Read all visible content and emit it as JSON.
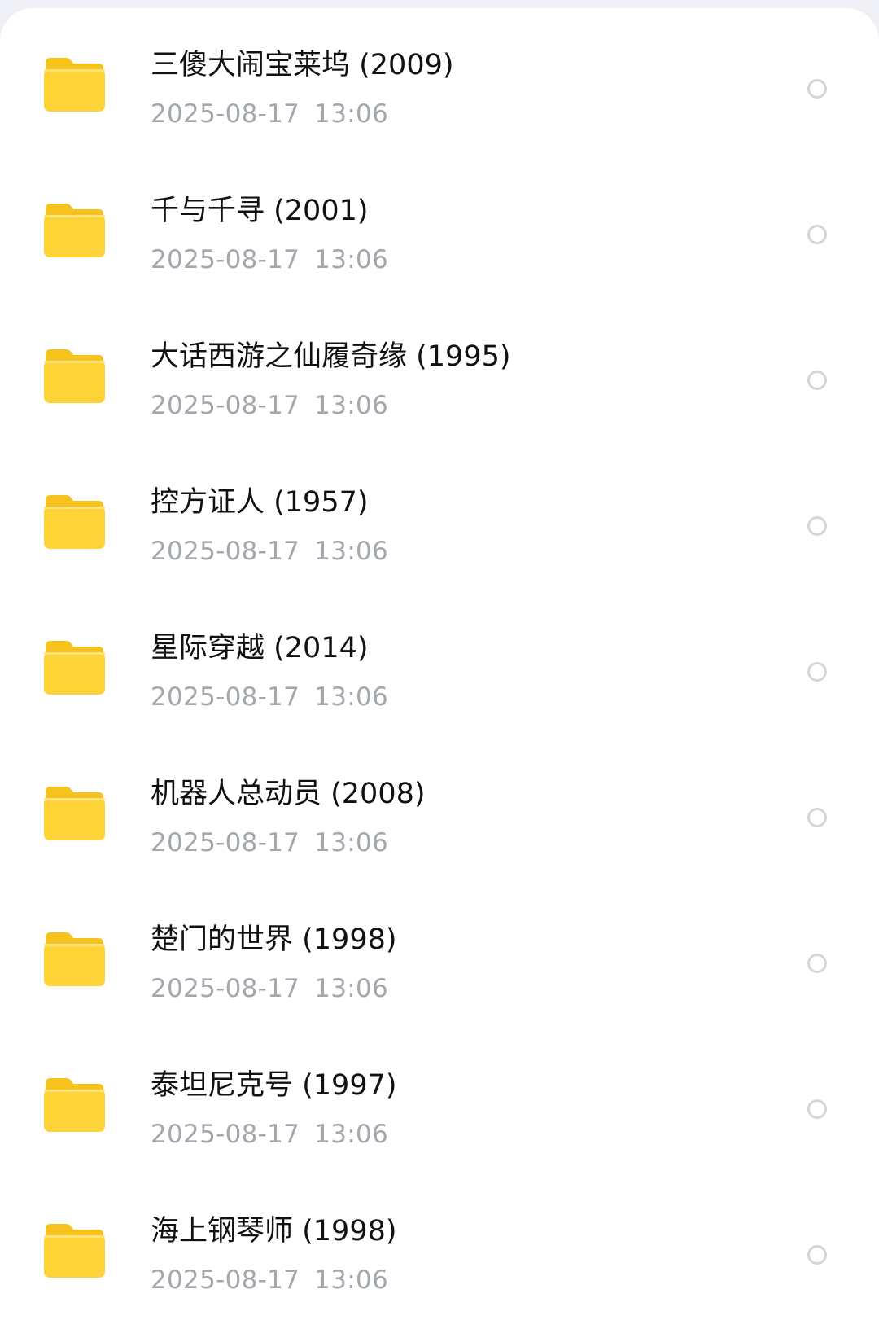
{
  "files": [
    {
      "name": "三傻大闹宝莱坞 (2009)",
      "date": "2025-08-17",
      "time": "13:06",
      "icon": "folder-icon"
    },
    {
      "name": "千与千寻 (2001)",
      "date": "2025-08-17",
      "time": "13:06",
      "icon": "folder-icon"
    },
    {
      "name": "大话西游之仙履奇缘 (1995)",
      "date": "2025-08-17",
      "time": "13:06",
      "icon": "folder-icon"
    },
    {
      "name": "控方证人 (1957)",
      "date": "2025-08-17",
      "time": "13:06",
      "icon": "folder-icon"
    },
    {
      "name": "星际穿越 (2014)",
      "date": "2025-08-17",
      "time": "13:06",
      "icon": "folder-icon"
    },
    {
      "name": "机器人总动员 (2008)",
      "date": "2025-08-17",
      "time": "13:06",
      "icon": "folder-icon"
    },
    {
      "name": "楚门的世界 (1998)",
      "date": "2025-08-17",
      "time": "13:06",
      "icon": "folder-icon"
    },
    {
      "name": "泰坦尼克号 (1997)",
      "date": "2025-08-17",
      "time": "13:06",
      "icon": "folder-icon"
    },
    {
      "name": "海上钢琴师 (1998)",
      "date": "2025-08-17",
      "time": "13:06",
      "icon": "folder-icon"
    }
  ],
  "colors": {
    "folder_front": "#fdd338",
    "folder_back": "#f6c31e",
    "radio_border": "#d4d6db",
    "date_text": "#a3a7ae",
    "name_text": "#111111"
  }
}
